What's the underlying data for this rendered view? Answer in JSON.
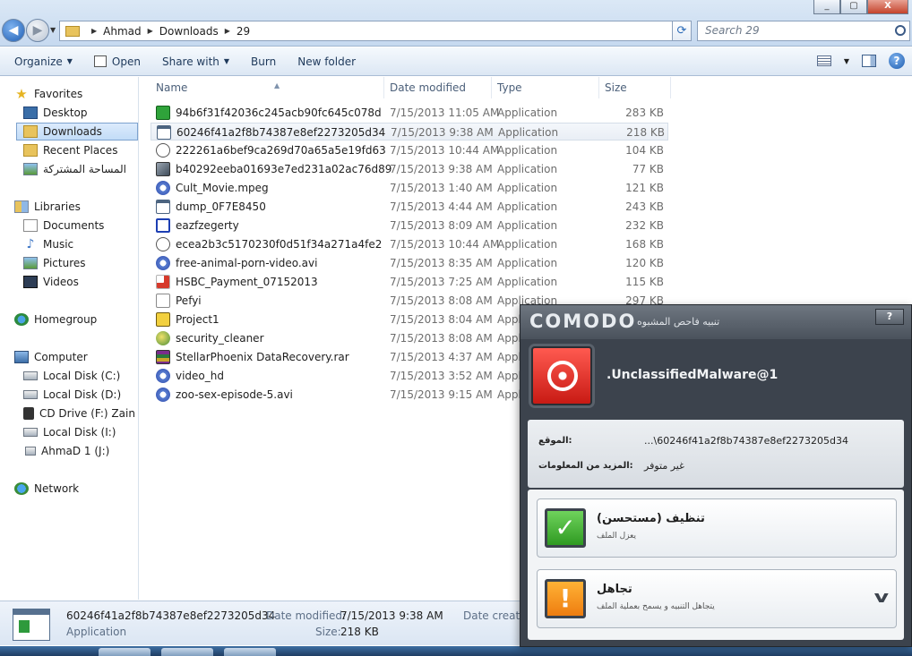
{
  "address": {
    "crumbs": [
      "Ahmad",
      "Downloads",
      "29"
    ],
    "search_placeholder": "Search 29"
  },
  "window_controls": {
    "minimize": "_",
    "maximize": "▢",
    "close": "X"
  },
  "toolbar": {
    "organize": "Organize",
    "open": "Open",
    "share_with": "Share with",
    "burn": "Burn",
    "new_folder": "New folder"
  },
  "sidebar": {
    "favorites": "Favorites",
    "desktop": "Desktop",
    "downloads": "Downloads",
    "recent_places": "Recent Places",
    "shared": "المساحة المشتركة",
    "libraries": "Libraries",
    "documents": "Documents",
    "music": "Music",
    "pictures": "Pictures",
    "videos": "Videos",
    "homegroup": "Homegroup",
    "computer": "Computer",
    "drive_c": "Local Disk (C:)",
    "drive_d": "Local Disk (D:)",
    "drive_f": "CD Drive (F:) Zain Br",
    "drive_i": "Local Disk (I:)",
    "drive_j": "AhmaD 1 (J:)",
    "network": "Network"
  },
  "columns": {
    "name": "Name",
    "date": "Date modified",
    "type": "Type",
    "size": "Size"
  },
  "files": [
    {
      "name": "94b6f31f42036c245acb90fc645c078d",
      "date": "7/15/2013 11:05 AM",
      "type": "Application",
      "size": "283 KB",
      "icon": "green-exe-icon"
    },
    {
      "name": "60246f41a2f8b74387e8ef2273205d34",
      "date": "7/15/2013 9:38 AM",
      "type": "Application",
      "size": "218 KB",
      "icon": "window-exe-icon"
    },
    {
      "name": "222261a6bef9ca269d70a65a5e19fd63",
      "date": "7/15/2013 10:44 AM",
      "type": "Application",
      "size": "104 KB",
      "icon": "mouse-icon"
    },
    {
      "name": "b40292eeba01693e7ed231a02ac76d89",
      "date": "7/15/2013 9:38 AM",
      "type": "Application",
      "size": "77 KB",
      "icon": "image-exe-icon"
    },
    {
      "name": "Cult_Movie.mpeg",
      "date": "7/15/2013 1:40 AM",
      "type": "Application",
      "size": "121 KB",
      "icon": "media-icon"
    },
    {
      "name": "dump_0F7E8450",
      "date": "7/15/2013 4:44 AM",
      "type": "Application",
      "size": "243 KB",
      "icon": "window-exe-icon"
    },
    {
      "name": "eazfzegerty",
      "date": "7/15/2013 8:09 AM",
      "type": "Application",
      "size": "232 KB",
      "icon": "blue-frame-icon"
    },
    {
      "name": "ecea2b3c5170230f0d51f34a271a4fe2",
      "date": "7/15/2013 10:44 AM",
      "type": "Application",
      "size": "168 KB",
      "icon": "mouse-icon"
    },
    {
      "name": "free-animal-porn-video.avi",
      "date": "7/15/2013 8:35 AM",
      "type": "Application",
      "size": "120 KB",
      "icon": "media-icon"
    },
    {
      "name": "HSBC_Payment_07152013",
      "date": "7/15/2013 7:25 AM",
      "type": "Application",
      "size": "115 KB",
      "icon": "pdf-icon"
    },
    {
      "name": "Pefyi",
      "date": "7/15/2013 8:08 AM",
      "type": "Application",
      "size": "297 KB",
      "icon": "document-icon"
    },
    {
      "name": "Project1",
      "date": "7/15/2013 8:04 AM",
      "type": "Application",
      "size": "",
      "icon": "project-icon"
    },
    {
      "name": "security_cleaner",
      "date": "7/15/2013 8:08 AM",
      "type": "Application",
      "size": "",
      "icon": "globe-icon"
    },
    {
      "name": "StellarPhoenix DataRecovery.rar",
      "date": "7/15/2013 4:37 AM",
      "type": "Application",
      "size": "",
      "icon": "rar-icon"
    },
    {
      "name": "video_hd",
      "date": "7/15/2013 3:52 AM",
      "type": "Application",
      "size": "",
      "icon": "media-icon"
    },
    {
      "name": "zoo-sex-episode-5.avi",
      "date": "7/15/2013 9:15 AM",
      "type": "Application",
      "size": "",
      "icon": "media-icon"
    }
  ],
  "details": {
    "name": "60246f41a2f8b74387e8ef2273205d34",
    "type": "Application",
    "date_label": "Date modified:",
    "date_value": "7/15/2013 9:38 AM",
    "size_label": "Size:",
    "size_value": "218 KB",
    "created_label": "Date created"
  },
  "comodo": {
    "logo": "COMODO",
    "alert_title": "تنبيه فاحص المشبوه",
    "help": "?",
    "threat": ".UnclassifiedMalware@1",
    "location_label": ":الموقع",
    "location_value": "...\\60246f41a2f8b74387e8ef2273205d34",
    "more_label": ":المزيد من المعلومات",
    "more_value": "غير متوفر",
    "clean_title": "تنظيف (مستحسن)",
    "clean_sub": "يعزل الملف",
    "ignore_title": "تجاهل",
    "ignore_sub": "يتجاهل التنبيه و يسمح بعملية الملف",
    "colors": {
      "threat_red": "#d42a22",
      "ok_green": "#3fae2e",
      "warn_orange": "#f28a1a",
      "panel": "#3c434d"
    }
  }
}
